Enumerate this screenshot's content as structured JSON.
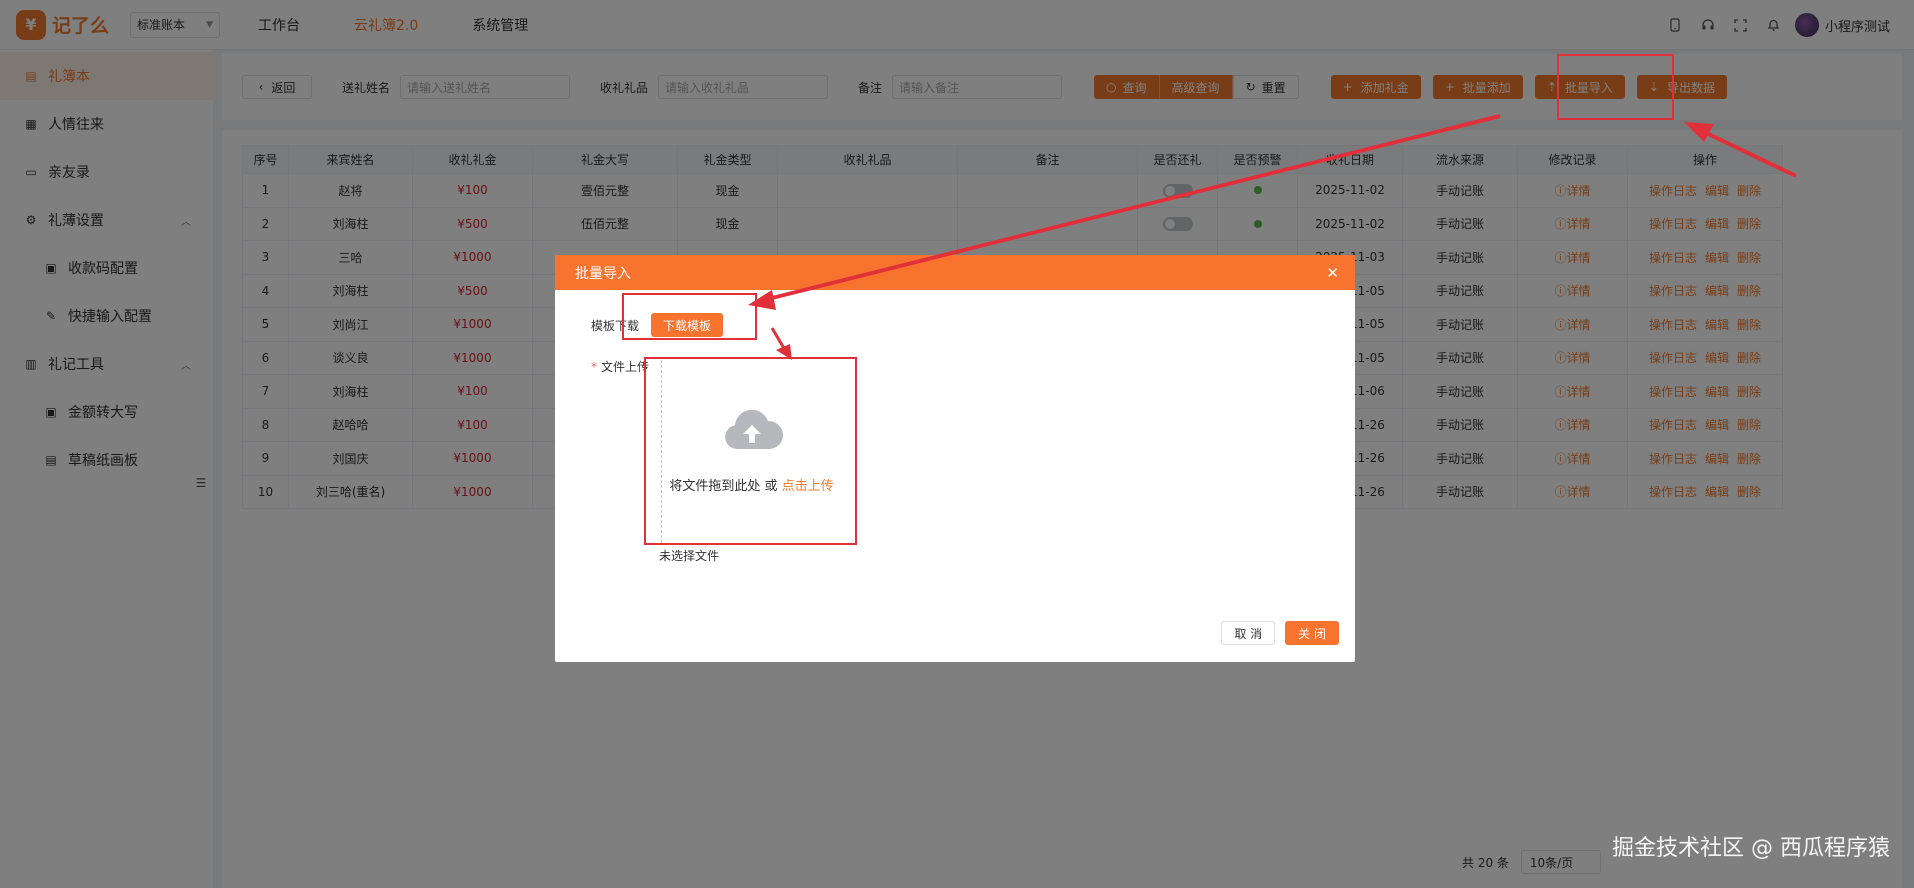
{
  "header": {
    "logo_char": "¥",
    "logo_text": "记了么",
    "account_select": "标准账本",
    "nav": [
      "工作台",
      "云礼簿2.0",
      "系统管理"
    ],
    "active_nav": "云礼簿2.0",
    "username": "小程序测试"
  },
  "sidebar": {
    "items": [
      {
        "label": "礼簿本",
        "icon": "book-icon",
        "active": true
      },
      {
        "label": "人情往来",
        "icon": "ledger-icon"
      },
      {
        "label": "亲友录",
        "icon": "folder-icon"
      },
      {
        "label": "礼薄设置",
        "icon": "gear-icon",
        "expandable": true
      },
      {
        "label": "收款码配置",
        "icon": "qrcode-icon",
        "sub": true
      },
      {
        "label": "快捷输入配置",
        "icon": "edit-icon",
        "sub": true
      },
      {
        "label": "礼记工具",
        "icon": "toolbox-icon",
        "expandable": true
      },
      {
        "label": "金额转大写",
        "icon": "money-icon",
        "sub": true
      },
      {
        "label": "草稿纸画板",
        "icon": "document-icon",
        "sub": true
      }
    ]
  },
  "filters": {
    "back": "返回",
    "giver_label": "送礼姓名",
    "giver_placeholder": "请输入送礼姓名",
    "gift_label": "收礼礼品",
    "gift_placeholder": "请输入收礼礼品",
    "note_label": "备注",
    "note_placeholder": "请输入备注",
    "query": "查询",
    "advanced_query": "高级查询",
    "reset": "重置",
    "add_gift": "添加礼金",
    "batch_add": "批量添加",
    "batch_import": "批量导入",
    "export": "导出数据"
  },
  "table": {
    "headers": [
      "序号",
      "来宾姓名",
      "收礼礼金",
      "礼金大写",
      "礼金类型",
      "收礼礼品",
      "备注",
      "是否还礼",
      "是否预警",
      "收礼日期",
      "流水来源",
      "修改记录",
      "操作"
    ],
    "rows": [
      {
        "no": "1",
        "name": "赵将",
        "amount": "¥100",
        "upper": "壹佰元整",
        "type": "现金",
        "warn": true,
        "date": "2025-11-02",
        "source": "手动记账"
      },
      {
        "no": "2",
        "name": "刘海柱",
        "amount": "¥500",
        "upper": "伍佰元整",
        "type": "现金",
        "warn": true,
        "date": "2025-11-02",
        "source": "手动记账"
      },
      {
        "no": "3",
        "name": "三哈",
        "amount": "¥1000",
        "upper": "",
        "type": "",
        "warn": false,
        "date": "2025-11-03",
        "source": "手动记账"
      },
      {
        "no": "4",
        "name": "刘海柱",
        "amount": "¥500",
        "upper": "",
        "type": "",
        "warn": false,
        "date": "2025-11-05",
        "source": "手动记账"
      },
      {
        "no": "5",
        "name": "刘尚江",
        "amount": "¥1000",
        "upper": "",
        "type": "",
        "warn": false,
        "date": "2025-11-05",
        "source": "手动记账"
      },
      {
        "no": "6",
        "name": "谈义良",
        "amount": "¥1000",
        "upper": "",
        "type": "",
        "warn": false,
        "date": "2025-11-05",
        "source": "手动记账"
      },
      {
        "no": "7",
        "name": "刘海柱",
        "amount": "¥100",
        "upper": "",
        "type": "",
        "warn": false,
        "date": "2025-11-06",
        "source": "手动记账"
      },
      {
        "no": "8",
        "name": "赵哈哈",
        "amount": "¥100",
        "upper": "",
        "type": "",
        "warn": false,
        "date": "2025-11-26",
        "source": "手动记账"
      },
      {
        "no": "9",
        "name": "刘国庆",
        "amount": "¥1000",
        "upper": "",
        "type": "",
        "warn": false,
        "date": "2025-11-26",
        "source": "手动记账"
      },
      {
        "no": "10",
        "name": "刘三哈(重名)",
        "amount": "¥1000",
        "upper": "",
        "type": "",
        "warn": false,
        "date": "2025-11-26",
        "source": "手动记账"
      }
    ],
    "detail": "详情",
    "ops": [
      "操作日志",
      "编辑",
      "删除"
    ]
  },
  "pager": {
    "total": "共 20 条",
    "page_size": "10条/页"
  },
  "modal": {
    "title": "批量导入",
    "template_label": "模板下载",
    "download_button": "下载模板",
    "upload_label": "文件上传",
    "drop_text": "将文件拖到此处 或 ",
    "click_upload": "点击上传",
    "no_file": "未选择文件",
    "cancel": "取 消",
    "close": "关 闭"
  },
  "watermark": "掘金技术社区 @ 西瓜程序猿",
  "colors": {
    "accent": "#f07b2f",
    "annotation": "#e2303a",
    "amount": "#d9232a"
  }
}
